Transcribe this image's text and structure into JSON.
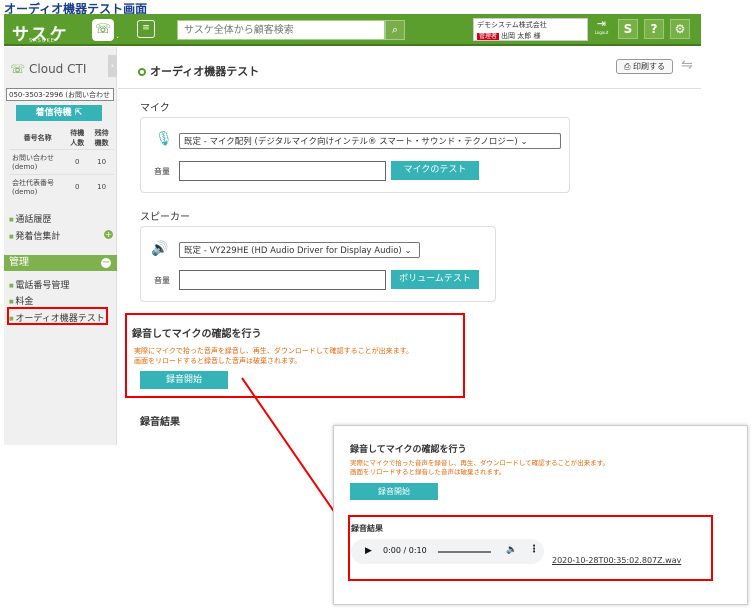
{
  "caption": "オーディオ機器テスト画面",
  "header": {
    "logo": "サスケ",
    "logo_sub": "SASUKE",
    "search_placeholder": "サスケ全体から顧客検索",
    "company": "デモシステム株式会社",
    "role": "管理者",
    "user": "出岡 太郎 様",
    "logout_label": "Logout"
  },
  "sidebar": {
    "title": "Cloud CTI",
    "phone_select": "050-3503-2996 (お問い合わせ",
    "call_wait": "着信待機",
    "queue_headers": [
      "番号名称",
      "待機人数",
      "残待機数"
    ],
    "queue_rows": [
      {
        "name": "お問い合わせ(demo)",
        "wait": "0",
        "remain": "10"
      },
      {
        "name": "会社代表番号(demo)",
        "wait": "0",
        "remain": "10"
      }
    ],
    "links": [
      "通話履歴",
      "発着信集計"
    ],
    "section": "管理",
    "admin_links": [
      "電話番号管理",
      "料金",
      "オーディオ機器テスト"
    ]
  },
  "main": {
    "title": "オーディオ機器テスト",
    "print": "印刷する",
    "mic_label": "マイク",
    "mic_select": "既定 - マイク配列 (デジタルマイク向けインテル® スマート・サウンド・テクノロジー)",
    "volume_label": "音量",
    "mic_test": "マイクのテスト",
    "speaker_label": "スピーカー",
    "speaker_select": "既定 - VY229HE (HD Audio Driver for Display Audio)",
    "volume_test": "ボリュームテスト",
    "rec_title": "録音してマイクの確認を行う",
    "rec_desc1": "実際にマイクで拾った音声を録音し、再生、ダウンロードして確認することが出来ます。",
    "rec_desc2": "画面をリロードすると録音した音声は破棄されます。",
    "rec_start": "録音開始",
    "result_title": "録音結果"
  },
  "zoom": {
    "rec_title": "録音してマイクの確認を行う",
    "rec_desc1": "実際にマイクで拾った音声を録音し、再生、ダウンロードして確認することが出来ます。",
    "rec_desc2": "画面をリロードすると録音した音声は破棄されます。",
    "rec_start": "録音開始",
    "result_title": "録音結果",
    "player_time": "0:00 / 0:10",
    "filename": "2020-10-28T00:35:02.807Z.wav"
  }
}
